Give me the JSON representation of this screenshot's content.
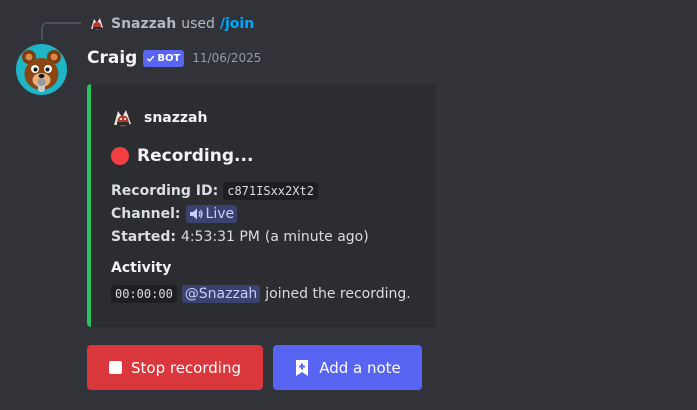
{
  "reply": {
    "username": "Snazzah",
    "used_text": "used",
    "command": "/join"
  },
  "message": {
    "author": "Craig",
    "bot_badge": "BOT",
    "timestamp": "11/06/2025",
    "avatar_icon": "bear-mascot-icon"
  },
  "embed": {
    "accent_color": "#23c55e",
    "author_name": "snazzah",
    "title": "Recording...",
    "fields": {
      "recording_id_label": "Recording ID:",
      "recording_id_value": "c871ISxx2Xt2",
      "channel_label": "Channel:",
      "channel_value": "Live",
      "started_label": "Started:",
      "started_value": "4:53:31 PM",
      "started_relative": "(a minute ago)"
    },
    "activity": {
      "title": "Activity",
      "entries": [
        {
          "time": "00:00:00",
          "mention": "@Snazzah",
          "text": "joined the recording."
        }
      ]
    }
  },
  "buttons": {
    "stop_label": "Stop recording",
    "note_label": "Add a note",
    "stop_color": "#da373c",
    "note_color": "#5865f2"
  }
}
